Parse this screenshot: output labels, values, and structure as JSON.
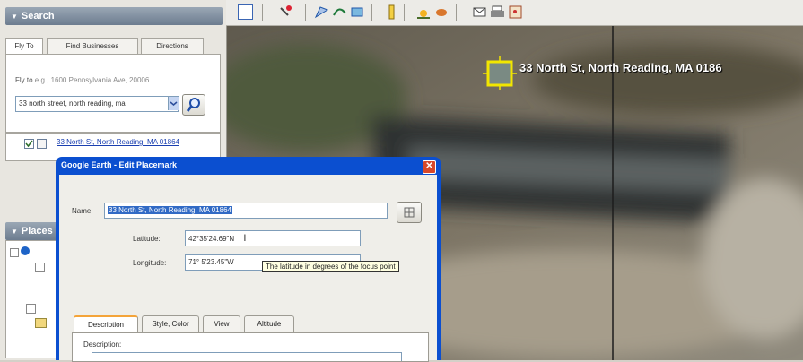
{
  "search_panel": {
    "header": "Search",
    "tabs": [
      "Fly To",
      "Find Businesses",
      "Directions"
    ],
    "fly_to_label": "Fly to",
    "fly_to_hint": "e.g., 1600 Pennsylvania Ave, 20006",
    "search_value": "33 north street, north reading, ma",
    "result_label": "33 North St, North Reading, MA 01864"
  },
  "places_panel": {
    "header": "Places"
  },
  "map": {
    "placemark_label": "33 North St, North Reading, MA 0186"
  },
  "dialog": {
    "title": "Google Earth - Edit Placemark",
    "close_glyph": "✕",
    "name_label": "Name:",
    "name_value": "33 North St, North Reading, MA 01864",
    "latitude_label": "Latitude:",
    "latitude_value": "42°35'24.69\"N",
    "longitude_label": "Longitude:",
    "longitude_value": "71° 5'23.45\"W",
    "tabs": [
      "Description",
      "Style, Color",
      "View",
      "Altitude"
    ],
    "description_label": "Description:"
  },
  "tooltip": {
    "text": "The latitude in degrees of the focus point"
  },
  "icons": {
    "search": "magnifier-icon",
    "dropdown": "chevron-down-icon",
    "placemark": "placemark-icon"
  },
  "colors": {
    "dialog_titlebar": "#0b4fd0",
    "placemark_square": "#f2e600",
    "link": "#1a3fb0"
  }
}
